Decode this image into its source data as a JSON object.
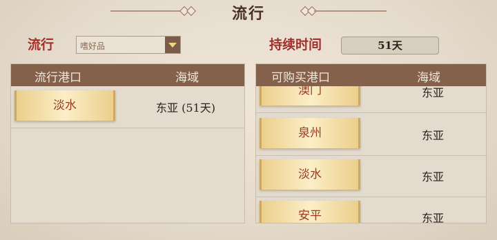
{
  "header": {
    "title": "流行"
  },
  "filter": {
    "label": "流行",
    "selected": "嗜好品"
  },
  "duration": {
    "label": "持续时间",
    "value": "51天"
  },
  "left_panel": {
    "columns": [
      "流行港口",
      "海域"
    ],
    "rows": [
      {
        "port": "淡水",
        "region": "东亚 (51天)"
      }
    ]
  },
  "right_panel": {
    "columns": [
      "可购买港口",
      "海域"
    ],
    "rows": [
      {
        "port": "澳门",
        "region": "东亚"
      },
      {
        "port": "泉州",
        "region": "东亚"
      },
      {
        "port": "淡水",
        "region": "东亚"
      },
      {
        "port": "安平",
        "region": "东亚"
      }
    ]
  }
}
